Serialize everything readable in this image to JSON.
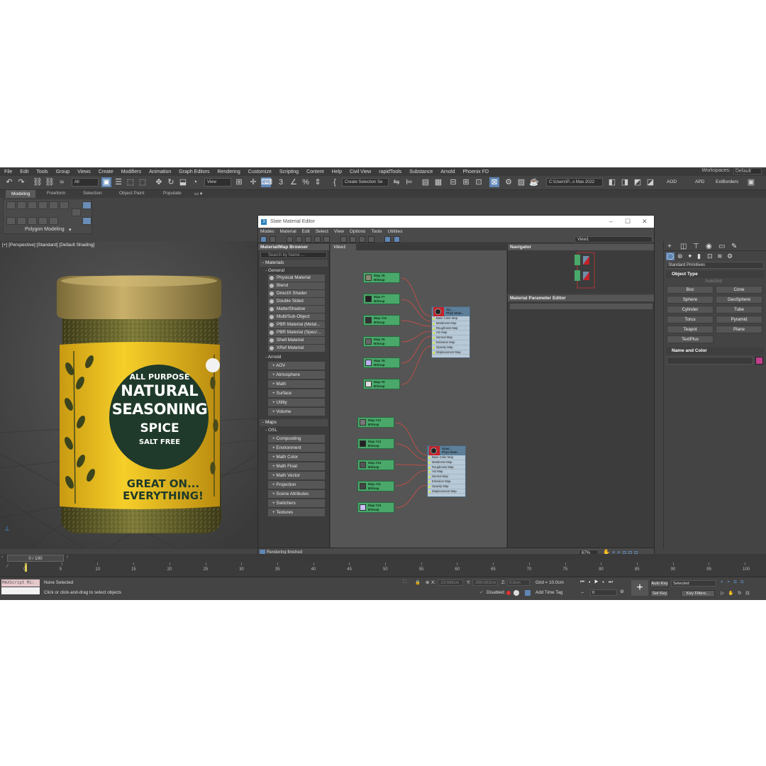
{
  "menu": [
    "File",
    "Edit",
    "Tools",
    "Group",
    "Views",
    "Create",
    "Modifiers",
    "Animation",
    "Graph Editors",
    "Rendering",
    "Customize",
    "Scripting",
    "Content",
    "Help",
    "Civil View",
    "rapidTools",
    "Substance",
    "Arnold",
    "Phoenix FD"
  ],
  "workspace": {
    "label": "Workspaces:",
    "value": "Default"
  },
  "toolbar": {
    "selection_filter": "All",
    "ref_coord": "View",
    "selection_set": "Create Selection Se",
    "path": "C:\\Users\\P...s Max 2022",
    "right_labels": [
      "AOD",
      "APD",
      "ExtBorders"
    ]
  },
  "ribbon": {
    "tabs": [
      "Modeling",
      "Freeform",
      "Selection",
      "Object Paint",
      "Populate"
    ],
    "active": "Modeling",
    "panel_label": "Polygon Modeling"
  },
  "viewport": {
    "label": "[+] [Perspective] [Standard] [Default Shading]",
    "jar_label": {
      "line1": "ALL PURPOSE",
      "line2": "NATURAL",
      "line3": "SEASONING",
      "line4": "SPICE",
      "line5": "SALT FREE",
      "line6": "GREAT ON...",
      "line7": "EVERYTHING!"
    },
    "colors": {
      "label_yellow": "#f2c51f",
      "label_green": "#1f3a2a",
      "lid": "#b9a057",
      "spice": "#6b6a2c"
    }
  },
  "sme": {
    "title": "Slate Material Editor",
    "menu": [
      "Modes",
      "Material",
      "Edit",
      "Select",
      "View",
      "Options",
      "Tools",
      "Utilities"
    ],
    "view_dropdown": "View1",
    "browser": {
      "header": "Material/Map Browser",
      "search": "Search by Name ...",
      "materials_label": "- Materials",
      "general_label": "- General",
      "general_items": [
        "Physical Material",
        "Blend",
        "DirectX Shader",
        "Double Sided",
        "Matte/Shadow",
        "Multi/Sub-Object",
        "PBR Material (Metal...",
        "PBR Material (Spec/...",
        "Shell Material",
        "XRef Material"
      ],
      "arnold_label": "- Arnold",
      "arnold_groups": [
        "+ AOV",
        "+ Atmosphere",
        "+ Math",
        "+ Surface",
        "+ Utility",
        "+ Volume"
      ],
      "maps_label": "- Maps",
      "osl_label": "- OSL",
      "osl_groups": [
        "+ Compositing",
        "+ Environment",
        "+ Math Color",
        "+ Math Float",
        "+ Math Vector",
        "+ Projection",
        "+ Scene Attributes",
        "+ Switchers",
        "+ Textures"
      ]
    },
    "view_tab": "View1",
    "nodes_top": [
      {
        "name": "Map #6",
        "type": "Bitmap"
      },
      {
        "name": "Map #7",
        "type": "Bitmap"
      },
      {
        "name": "Map #10",
        "type": "Bitmap"
      },
      {
        "name": "Map #5",
        "type": "Bitmap"
      },
      {
        "name": "Map #8",
        "type": "Bitmap"
      },
      {
        "name": "Map #9",
        "type": "Bitmap"
      }
    ],
    "nodes_bottom": [
      {
        "name": "Map #12",
        "type": "Bitmap"
      },
      {
        "name": "Map #13",
        "type": "Bitmap"
      },
      {
        "name": "Map #14",
        "type": "Bitmap"
      },
      {
        "name": "Map #11",
        "type": "Bitmap"
      },
      {
        "name": "Map #15",
        "type": "Bitmap"
      }
    ],
    "material_node_1": {
      "title": "Jar_...",
      "sub": "Phys Mate..."
    },
    "material_node_2": {
      "title": "Seas...",
      "sub": "Phys Mate..."
    },
    "material_slots": [
      "Base Color Map",
      "Metalness Map",
      "Roughness Map",
      "AO Map",
      "Normal Map",
      "Emission Map",
      "Opacity Map",
      "Displacement Map"
    ],
    "navigator": "Navigator",
    "param_editor": "Material Parameter Editor",
    "status": "Rendering finished",
    "zoom": "67%"
  },
  "command_panel": {
    "category": "Standard Primitives",
    "object_type": "Object Type",
    "autogrid": "AutoGrid",
    "primitives": [
      "Box",
      "Cone",
      "Sphere",
      "GeoSphere",
      "Cylinder",
      "Tube",
      "Torus",
      "Pyramid",
      "Teapot",
      "Plane",
      "TextPlus"
    ],
    "name_color": "Name and Color",
    "object_color": "#c23f8c"
  },
  "timeline": {
    "slider": "0 / 100",
    "ticks": [
      "0",
      "5",
      "10",
      "15",
      "20",
      "25",
      "30",
      "35",
      "40",
      "45",
      "50",
      "55",
      "60",
      "65",
      "70",
      "75",
      "80",
      "85",
      "90",
      "95",
      "100"
    ]
  },
  "status_bar": {
    "maxscript": "MAXScript Mi:",
    "selection": "None Selected",
    "prompt": "Click or click-and-drag to select objects",
    "x_label": "X:",
    "x_val": "-13.666cm",
    "y_label": "Y:",
    "y_val": "-200.053cm",
    "z_label": "Z:",
    "z_val": "0.0cm",
    "grid": "Grid = 10.0cm",
    "disabled": "Disabled:",
    "add_time_tag": "Add Time Tag",
    "auto_key": "Auto Key",
    "selected": "Selected",
    "set_key": "Set Key",
    "key_filters": "Key Filters...",
    "frame": "0"
  }
}
